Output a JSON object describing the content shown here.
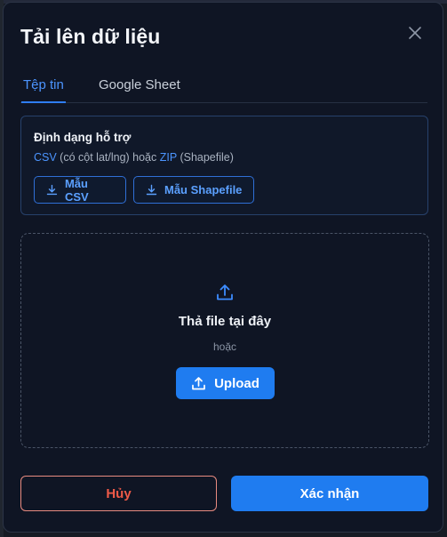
{
  "modal": {
    "title": "Tải lên dữ liệu"
  },
  "tabs": [
    {
      "label": "Tệp tin",
      "active": true
    },
    {
      "label": "Google Sheet",
      "active": false
    }
  ],
  "formats": {
    "title": "Định dạng hỗ trợ",
    "csv_label": "CSV",
    "csv_note": " (có cột lat/lng) hoặc ",
    "zip_label": "ZIP",
    "zip_note": " (Shapefile)",
    "csv_template_label": "Mẫu CSV",
    "shapefile_template_label": "Mẫu Shapefile"
  },
  "dropzone": {
    "title": "Thả file tại đây",
    "or_text": "hoặc",
    "upload_label": "Upload"
  },
  "footer": {
    "cancel_label": "Hủy",
    "confirm_label": "Xác nhận"
  },
  "colors": {
    "accent": "#1f7cf0",
    "link": "#4c95ff",
    "danger": "#ee5a48",
    "modal_bg": "#0f1524"
  },
  "icons": {
    "close": "close-icon",
    "download": "download-icon",
    "upload": "upload-icon"
  }
}
